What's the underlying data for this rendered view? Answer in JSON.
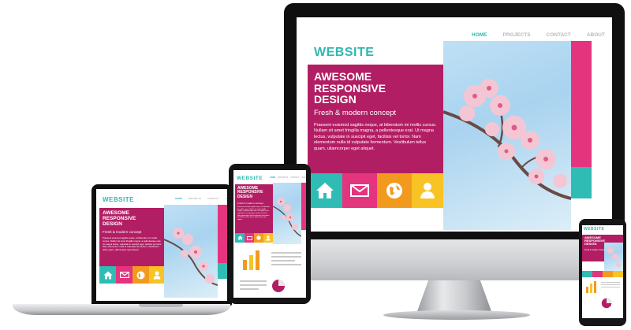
{
  "site": {
    "brand": "WEBSITE",
    "nav": [
      "HOME",
      "PROJECTS",
      "CONTACT",
      "ABOUT"
    ],
    "hero_title": "AWESOME\nRESPONSIVE\nDESIGN",
    "hero_subtitle": "Fresh & modern concept",
    "hero_body": "Praesent euismod sagittis neque, at bibendum mi mollis cursus. Nullam sit amet fringilla magna, a pellentesque erat. Ut magna lectus, vulputate in suscipit eget, facilisis vel tortor. Nam elementum nulla id vulputate fermentum. Vestibulum tellus quam, ullamcorper eget aliquet.",
    "tiles": [
      {
        "icon": "home-icon",
        "color": "#2fbcb4"
      },
      {
        "icon": "mail-icon",
        "color": "#e4347e"
      },
      {
        "icon": "globe-icon",
        "color": "#f29a1d"
      },
      {
        "icon": "user-icon",
        "color": "#f7c325"
      }
    ]
  },
  "colors": {
    "brand": "#2fb8b0",
    "hero": "#b21e63",
    "teal": "#2fbcb4",
    "pink": "#e4347e",
    "orange": "#f29a1d",
    "yellow": "#f7c325"
  }
}
